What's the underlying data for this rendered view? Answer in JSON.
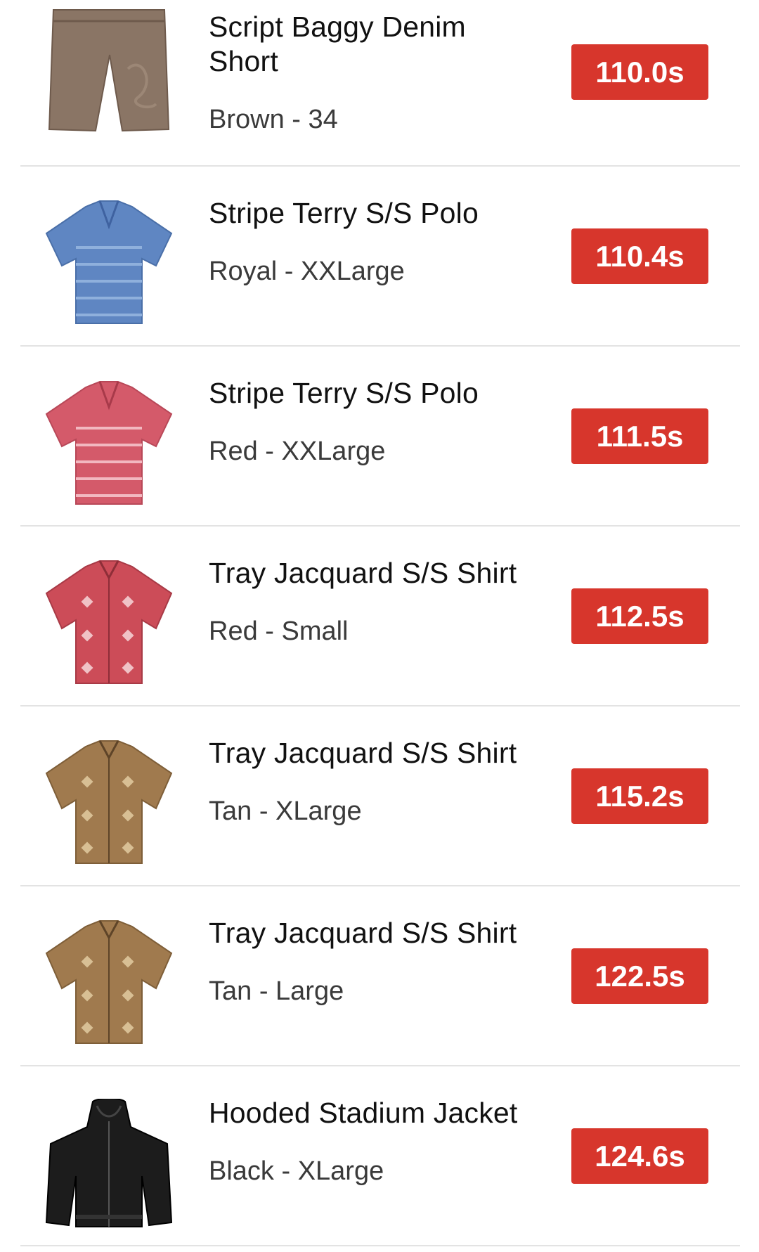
{
  "items": [
    {
      "name": "Script Baggy Denim Short",
      "variant": "Brown - 34",
      "time": "110.0s",
      "color": "#8a7565",
      "image": "shorts-icon"
    },
    {
      "name": "Stripe Terry S/S Polo",
      "variant": "Royal - XXLarge",
      "time": "110.4s",
      "color": "#5f86c2",
      "image": "polo-shirt-icon"
    },
    {
      "name": "Stripe Terry S/S Polo",
      "variant": "Red - XXLarge",
      "time": "111.5s",
      "color": "#d45a6a",
      "image": "polo-shirt-icon"
    },
    {
      "name": "Tray Jacquard S/S Shirt",
      "variant": "Red - Small",
      "time": "112.5s",
      "color": "#cc4c58",
      "image": "shirt-icon"
    },
    {
      "name": "Tray Jacquard S/S Shirt",
      "variant": "Tan - XLarge",
      "time": "115.2s",
      "color": "#a07a4e",
      "image": "shirt-icon"
    },
    {
      "name": "Tray Jacquard S/S Shirt",
      "variant": "Tan - Large",
      "time": "122.5s",
      "color": "#a07a4e",
      "image": "shirt-icon"
    },
    {
      "name": "Hooded Stadium Jacket",
      "variant": "Black - XLarge",
      "time": "124.6s",
      "color": "#1c1c1c",
      "image": "jacket-icon"
    }
  ],
  "badge_color": "#d7362c"
}
